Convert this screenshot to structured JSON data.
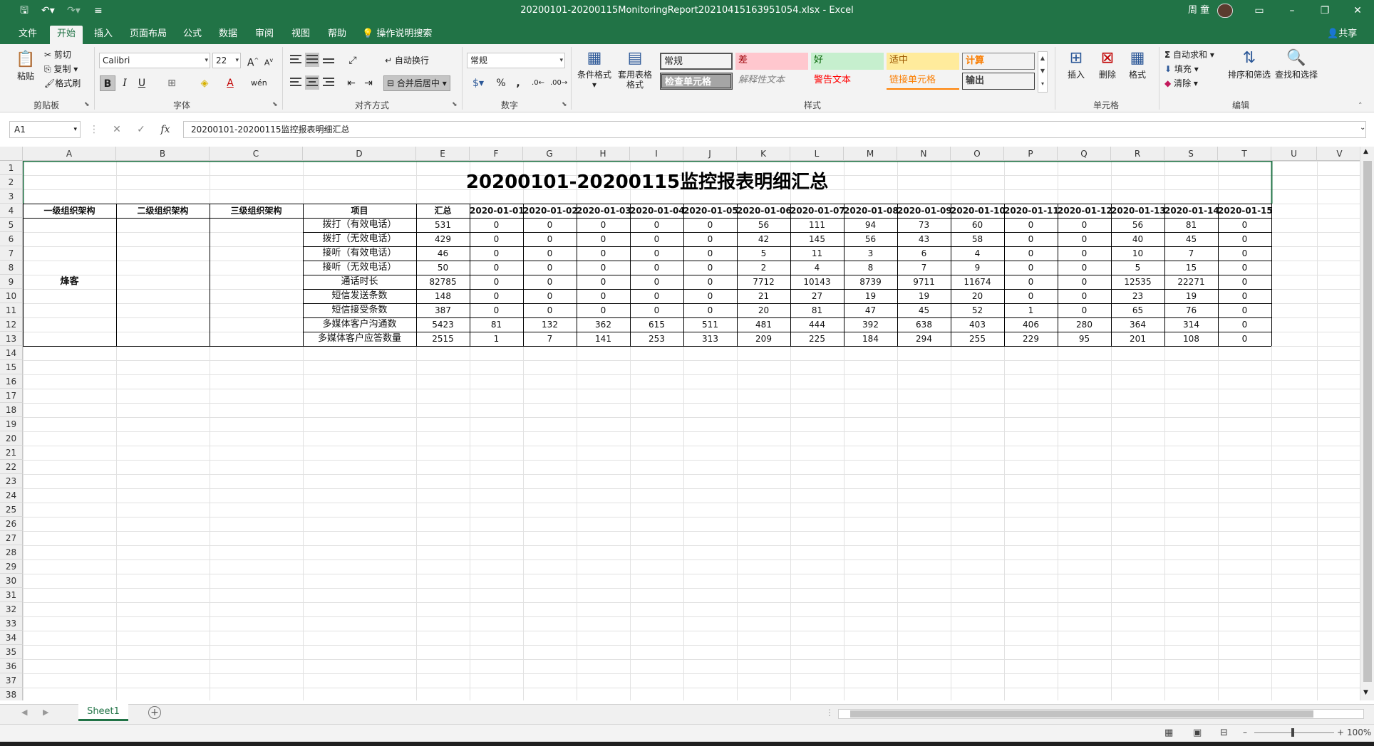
{
  "window": {
    "title": "20200101-20200115MonitoringReport20210415163951054.xlsx  -  Excel",
    "user": "周 童"
  },
  "tabs": [
    "文件",
    "开始",
    "插入",
    "页面布局",
    "公式",
    "数据",
    "审阅",
    "视图",
    "帮助"
  ],
  "active_tab": "开始",
  "tell_me": "操作说明搜索",
  "share": "共享",
  "ribbon": {
    "clipboard": {
      "paste": "粘贴",
      "cut": "剪切",
      "copy": "复制",
      "painter": "格式刷",
      "label": "剪贴板"
    },
    "font": {
      "name": "Calibri",
      "size": "22",
      "label": "字体",
      "bold": "B",
      "italic": "I",
      "underline": "U"
    },
    "alignment": {
      "wrap": "自动换行",
      "merge": "合并后居中",
      "label": "对齐方式"
    },
    "number": {
      "format": "常规",
      "label": "数字",
      "percent": "%",
      "comma": ","
    },
    "styles": {
      "cond": "条件格式",
      "table": "套用表格格式",
      "label": "样式",
      "cells": [
        {
          "text": "常规",
          "bg": "#ffffff",
          "fg": "#000000"
        },
        {
          "text": "差",
          "bg": "#ffc7ce",
          "fg": "#9c0006"
        },
        {
          "text": "好",
          "bg": "#c6efce",
          "fg": "#006100"
        },
        {
          "text": "适中",
          "bg": "#ffeb9c",
          "fg": "#9c5700"
        },
        {
          "text": "计算",
          "bg": "#f2f2f2",
          "fg": "#fa7d00"
        },
        {
          "text": "检查单元格",
          "bg": "#a5a5a5",
          "fg": "#ffffff"
        },
        {
          "text": "解释性文本",
          "bg": "#ffffff",
          "fg": "#7f7f7f"
        },
        {
          "text": "警告文本",
          "bg": "#ffffff",
          "fg": "#ff0000"
        },
        {
          "text": "链接单元格",
          "bg": "#ffffff",
          "fg": "#fa7d00"
        },
        {
          "text": "输出",
          "bg": "#f2f2f2",
          "fg": "#3f3f3f"
        }
      ]
    },
    "cells": {
      "insert": "插入",
      "delete": "删除",
      "format": "格式",
      "label": "单元格"
    },
    "editing": {
      "autosum": "自动求和",
      "fill": "填充",
      "clear": "清除",
      "sort": "排序和筛选",
      "find": "查找和选择",
      "label": "编辑"
    }
  },
  "formula_bar": {
    "name_box": "A1",
    "fx": "fx",
    "content": "20200101-20200115监控报表明细汇总"
  },
  "columns": [
    "A",
    "B",
    "C",
    "D",
    "E",
    "F",
    "G",
    "H",
    "I",
    "J",
    "K",
    "L",
    "M",
    "N",
    "O",
    "P",
    "Q",
    "R",
    "S",
    "T",
    "U",
    "V"
  ],
  "sheet": {
    "title": "20200101-20200115监控报表明细汇总",
    "headers": [
      "一级组织架构",
      "二级组织架构",
      "三级组织架构",
      "项目",
      "汇总",
      "2020-01-01",
      "2020-01-02",
      "2020-01-03",
      "2020-01-04",
      "2020-01-05",
      "2020-01-06",
      "2020-01-07",
      "2020-01-08",
      "2020-01-09",
      "2020-01-10",
      "2020-01-11",
      "2020-01-12",
      "2020-01-13",
      "2020-01-14",
      "2020-01-15"
    ],
    "org_level1": "烽客",
    "rows": [
      {
        "item": "拨打（有效电话）",
        "total": "531",
        "values": [
          "0",
          "0",
          "0",
          "0",
          "0",
          "56",
          "111",
          "94",
          "73",
          "60",
          "0",
          "0",
          "56",
          "81",
          "0"
        ]
      },
      {
        "item": "拨打（无效电话）",
        "total": "429",
        "values": [
          "0",
          "0",
          "0",
          "0",
          "0",
          "42",
          "145",
          "56",
          "43",
          "58",
          "0",
          "0",
          "40",
          "45",
          "0"
        ]
      },
      {
        "item": "接听（有效电话）",
        "total": "46",
        "values": [
          "0",
          "0",
          "0",
          "0",
          "0",
          "5",
          "11",
          "3",
          "6",
          "4",
          "0",
          "0",
          "10",
          "7",
          "0"
        ]
      },
      {
        "item": "接听（无效电话）",
        "total": "50",
        "values": [
          "0",
          "0",
          "0",
          "0",
          "0",
          "2",
          "4",
          "8",
          "7",
          "9",
          "0",
          "0",
          "5",
          "15",
          "0"
        ]
      },
      {
        "item": "通话时长",
        "total": "82785",
        "values": [
          "0",
          "0",
          "0",
          "0",
          "0",
          "7712",
          "10143",
          "8739",
          "9711",
          "11674",
          "0",
          "0",
          "12535",
          "22271",
          "0"
        ]
      },
      {
        "item": "短信发送条数",
        "total": "148",
        "values": [
          "0",
          "0",
          "0",
          "0",
          "0",
          "21",
          "27",
          "19",
          "19",
          "20",
          "0",
          "0",
          "23",
          "19",
          "0"
        ]
      },
      {
        "item": "短信接受条数",
        "total": "387",
        "values": [
          "0",
          "0",
          "0",
          "0",
          "0",
          "20",
          "81",
          "47",
          "45",
          "52",
          "1",
          "0",
          "65",
          "76",
          "0"
        ]
      },
      {
        "item": "多媒体客户沟通数",
        "total": "5423",
        "values": [
          "81",
          "132",
          "362",
          "615",
          "511",
          "481",
          "444",
          "392",
          "638",
          "403",
          "406",
          "280",
          "364",
          "314",
          "0"
        ]
      },
      {
        "item": "多媒体客户应答数量",
        "total": "2515",
        "values": [
          "1",
          "7",
          "141",
          "253",
          "313",
          "209",
          "225",
          "184",
          "294",
          "255",
          "229",
          "95",
          "201",
          "108",
          "0"
        ]
      }
    ]
  },
  "sheet_tab": "Sheet1",
  "zoom": "100%"
}
